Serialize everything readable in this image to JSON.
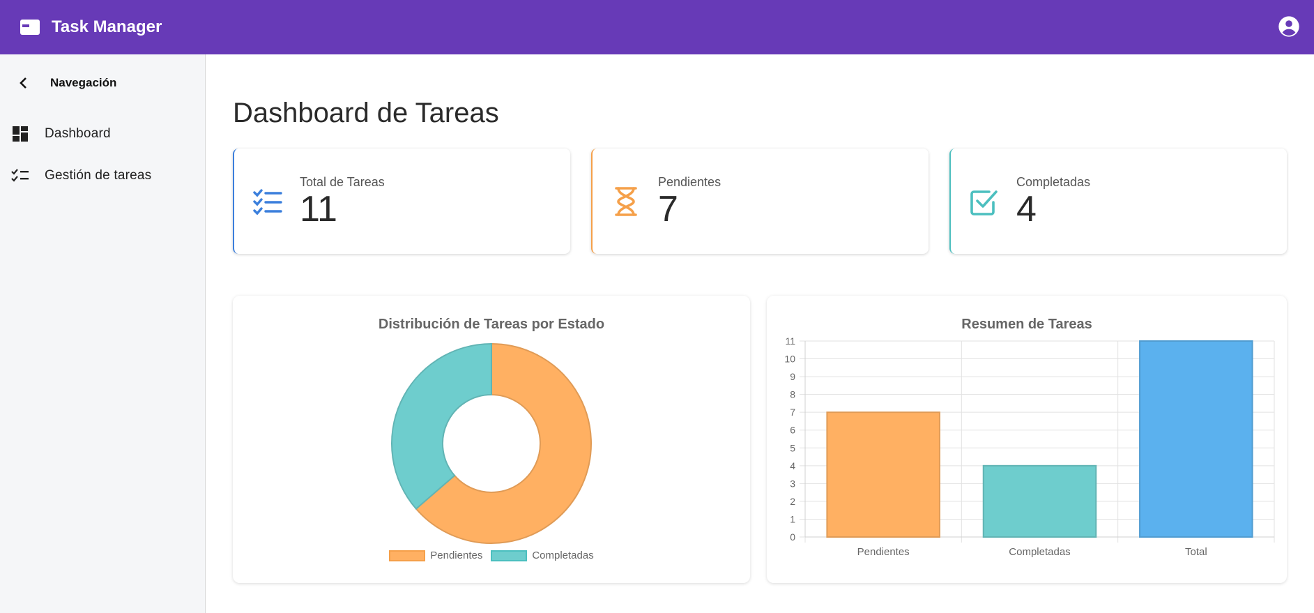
{
  "app": {
    "title": "Task Manager"
  },
  "sidebar": {
    "header": "Navegación",
    "items": [
      {
        "label": "Dashboard"
      },
      {
        "label": "Gestión de tareas"
      }
    ]
  },
  "main": {
    "title": "Dashboard de Tareas"
  },
  "stats": [
    {
      "label": "Total de Tareas",
      "value": "11",
      "color": "#3b7fdc"
    },
    {
      "label": "Pendientes",
      "value": "7",
      "color": "#f5a04a"
    },
    {
      "label": "Completadas",
      "value": "4",
      "color": "#4cbfbf"
    }
  ],
  "chart_data": [
    {
      "type": "pie",
      "title": "Distribución de Tareas por Estado",
      "categories": [
        "Pendientes",
        "Completadas"
      ],
      "values": [
        7,
        4
      ],
      "colors": [
        "#ffb062",
        "#6ecdcd"
      ],
      "legend_position": "bottom"
    },
    {
      "type": "bar",
      "title": "Resumen de Tareas",
      "categories": [
        "Pendientes",
        "Completadas",
        "Total"
      ],
      "values": [
        7,
        4,
        11
      ],
      "colors": [
        "#ffb062",
        "#6ecdcd",
        "#5bb1ee"
      ],
      "ylim": [
        0,
        11
      ],
      "yticks": [
        0,
        1,
        2,
        3,
        4,
        5,
        6,
        7,
        8,
        9,
        10,
        11
      ],
      "grid": true
    }
  ]
}
